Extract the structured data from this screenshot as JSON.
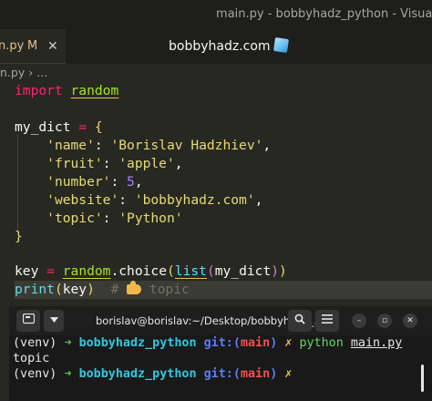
{
  "window": {
    "title": "main.py - bobbyhadz_python - Visual"
  },
  "tab": {
    "label": "n.py",
    "modified_marker": "M",
    "close_glyph": "✕"
  },
  "brand": {
    "text": "bobbyhadz.com",
    "icon": "ice-cube-icon"
  },
  "breadcrumb": {
    "text": "n.py › ..."
  },
  "code": {
    "line1": {
      "kw": "import",
      "mod": "random"
    },
    "line3": {
      "name": "my_dict",
      "op": "=",
      "brace": "{"
    },
    "entries": [
      {
        "key": "'name'",
        "sep": ": ",
        "val": "'Borislav Hadzhiev'",
        "tail": ","
      },
      {
        "key": "'fruit'",
        "sep": ": ",
        "val": "'apple'",
        "tail": ","
      },
      {
        "key": "'number'",
        "sep": ": ",
        "val": "5",
        "tail": ","
      },
      {
        "key": "'website'",
        "sep": ": ",
        "val": "'bobbyhadz.com'",
        "tail": ","
      },
      {
        "key": "'topic'",
        "sep": ": ",
        "val": "'Python'",
        "tail": ""
      }
    ],
    "close_brace": "}",
    "line10": {
      "name": "key",
      "op": "=",
      "mod": "random",
      "dot": ".",
      "call": "choice",
      "p1": "(",
      "fn": "list",
      "p2": "(",
      "arg": "my_dict",
      "p3": ")",
      "p4": ")"
    },
    "line11": {
      "fn": "print",
      "p1": "(",
      "arg": "key",
      "p2": ")",
      "comment_hash": "#",
      "comment_text": "topic",
      "comment_icon": "pointing-hand-icon"
    }
  },
  "terminal": {
    "title": "borislav@borislav:~/Desktop/bobbyhadz_...",
    "buttons": {
      "new_tab": "new-terminal-icon",
      "dropdown": "chevron-down-icon",
      "search": "search-icon",
      "menu": "hamburger-menu-icon",
      "minimize": "–",
      "maximize": "▫",
      "close": "✕"
    },
    "lines": [
      {
        "venv": "(venv)",
        "arrow": "➜",
        "dir": "bobbyhadz_python",
        "git": "git:(",
        "branch": "main",
        "git_close": ")",
        "x": "✗",
        "cmd": "python",
        "arg": "main.py"
      },
      {
        "output": "topic"
      },
      {
        "venv": "(venv)",
        "arrow": "➜",
        "dir": "bobbyhadz_python",
        "git": "git:(",
        "branch": "main",
        "git_close": ")",
        "x": "✗"
      }
    ]
  }
}
